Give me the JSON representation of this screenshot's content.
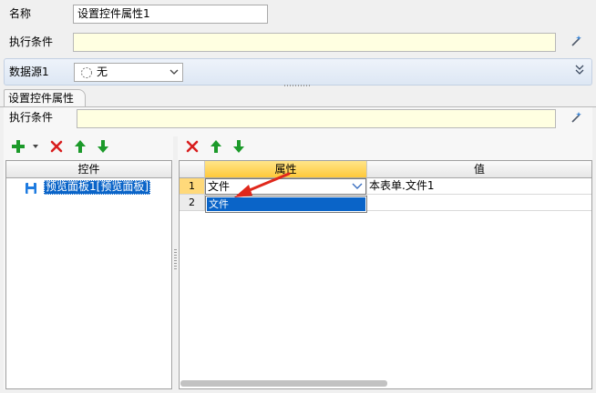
{
  "form": {
    "name_label": "名称",
    "name_value": "设置控件属性1",
    "condition_label": "执行条件",
    "condition_value": ""
  },
  "data_source": {
    "label": "数据源1",
    "selected": "无"
  },
  "tab": {
    "label": "设置控件属性",
    "condition_label": "执行条件",
    "condition_value": ""
  },
  "left_panel": {
    "header": "控件",
    "items": [
      {
        "label": "预览面板1[预览面板]",
        "icon": "save-icon"
      }
    ]
  },
  "right_panel": {
    "columns": [
      "属性",
      "值"
    ],
    "rows": [
      {
        "num": "1",
        "property": "文件",
        "value": "本表单.文件1"
      },
      {
        "num": "2",
        "property": "",
        "value": ""
      }
    ],
    "dropdown_options": [
      "文件"
    ]
  },
  "colors": {
    "condition_bg": "#ffffe1",
    "header_active": "#ffc93a",
    "selection": "#0a64c8",
    "delete_red": "#d81e1e",
    "arrow_green": "#1c9a2a",
    "pointer_arrow": "#e0281c"
  },
  "icons": {
    "wand": "magic-wand-icon",
    "add": "plus-icon",
    "delete": "delete-x-icon",
    "up": "arrow-up-icon",
    "down": "arrow-down-icon",
    "expand": "double-chevron-down-icon"
  }
}
